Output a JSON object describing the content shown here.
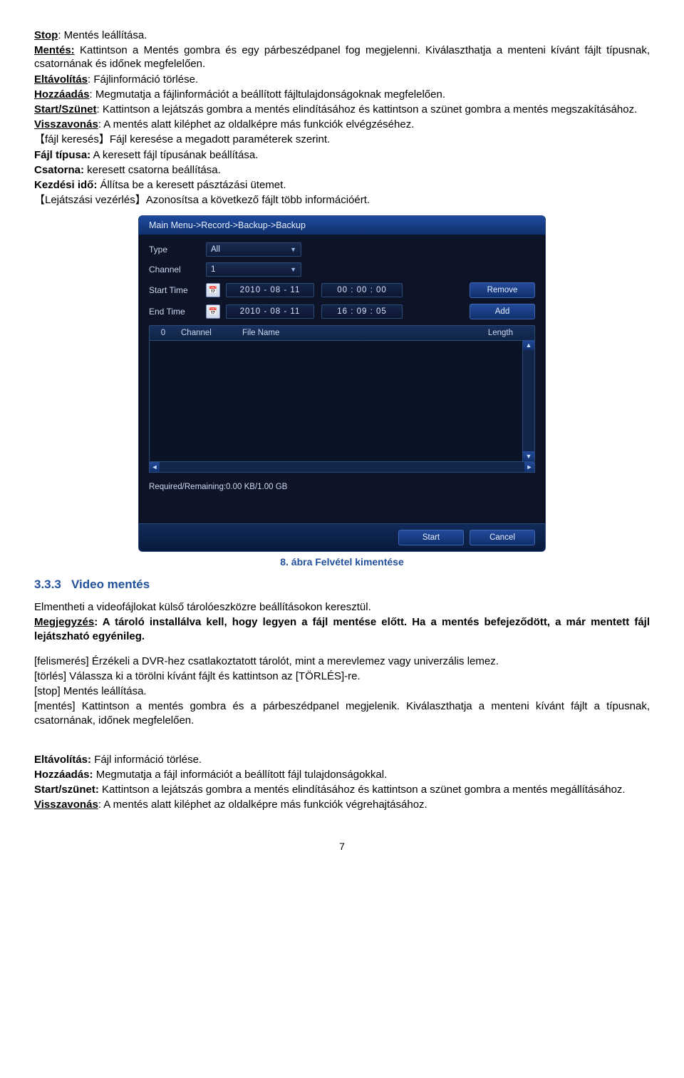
{
  "para1": {
    "stop_lbl": "Stop",
    "stop_txt": ": Mentés leállítása.",
    "mentes_lbl": "Mentés:",
    "mentes_txt": " Kattintson a Mentés gombra és egy párbeszédpanel fog megjelenni. Kiválaszthatja a menteni kívánt fájlt típusnak, csatornának és időnek megfelelően.",
    "eltav_lbl": "Eltávolítás",
    "eltav_txt": ": Fájlinformáció törlése.",
    "hozz_lbl": "Hozzáadás",
    "hozz_txt": ": Megmutatja a fájlinformációt a beállított fájltulajdonságoknak megfelelően.",
    "start_lbl": "Start/Szünet",
    "start_txt": ": Kattintson a lejátszás gombra a mentés elindításához és kattintson a szünet gombra a mentés megszakításához.",
    "vissza_lbl": "Visszavonás",
    "vissza_txt": ": A mentés alatt kiléphet az oldalképre más funkciók elvégzéséhez.",
    "fajlker": "【fájl keresés】Fájl keresése a megadott paraméterek szerint.",
    "fajltip_lbl": "Fájl típusa:",
    "fajltip_txt": " A keresett fájl típusának beállítása.",
    "csat_lbl": "Csatorna:",
    "csat_txt": " keresett csatorna beállítása.",
    "kezd_lbl": "Kezdési idő:",
    "kezd_txt": " Állítsa be a keresett pásztázási ütemet.",
    "lejvez": "【Lejátszási vezérlés】Azonosítsa a következő fájlt több információért."
  },
  "dialog": {
    "title": "Main Menu->Record->Backup->Backup",
    "type_lbl": "Type",
    "type_val": "All",
    "channel_lbl": "Channel",
    "channel_val": "1",
    "start_lbl": "Start Time",
    "start_date": "2010  -  08  -  11",
    "start_time": "00 : 00 : 00",
    "end_lbl": "End Time",
    "end_date": "2010  -  08  -  11",
    "end_time": "16 : 09 : 05",
    "remove_btn": "Remove",
    "add_btn": "Add",
    "col0": "0",
    "col1": "Channel",
    "col2": "File Name",
    "col3": "Length",
    "required": "Required/Remaining:0.00 KB/1.00 GB",
    "start_btn": "Start",
    "cancel_btn": "Cancel"
  },
  "caption": "8. ábra Felvétel kimentése",
  "section": {
    "num": "3.3.3",
    "title": "Video mentés"
  },
  "para2": {
    "line1": "Elmentheti a videofájlokat külső tárolóeszközre beállításokon keresztül.",
    "megj_lbl": "Megjegyzés",
    "megj_txt": ": A tároló installálva kell, hogy legyen a fájl mentése előtt. Ha a mentés befejeződött, a már mentett fájl lejátszható egyénileg.",
    "felism": " [felismerés] Érzékeli a DVR-hez csatlakoztatott tárolót, mint a merevlemez vagy univerzális lemez.",
    "torles": "[törlés] Válassza ki a törölni kívánt fájlt és kattintson az [TÖRLÉS]-re.",
    "stop": "[stop] Mentés leállítása.",
    "mentes": "[mentés] Kattintson a mentés gombra és a párbeszédpanel megjelenik. Kiválaszthatja a menteni kívánt fájlt a típusnak, csatornának, időnek megfelelően."
  },
  "para3": {
    "eltav_lbl": "Eltávolítás:",
    "eltav_txt": " Fájl információ törlése.",
    "hozz_lbl": "Hozzáadás:",
    "hozz_txt": " Megmutatja a fájl információt a beállított fájl tulajdonságokkal.",
    "start_lbl": "Start/szünet:",
    "start_txt": " Kattintson a lejátszás gombra a mentés elindításához és kattintson a szünet gombra a mentés megállításához.",
    "vissza_lbl": "Visszavonás",
    "vissza_txt": ": A mentés alatt kiléphet az oldalképre más funkciók végrehajtásához."
  },
  "pagenum": "7"
}
